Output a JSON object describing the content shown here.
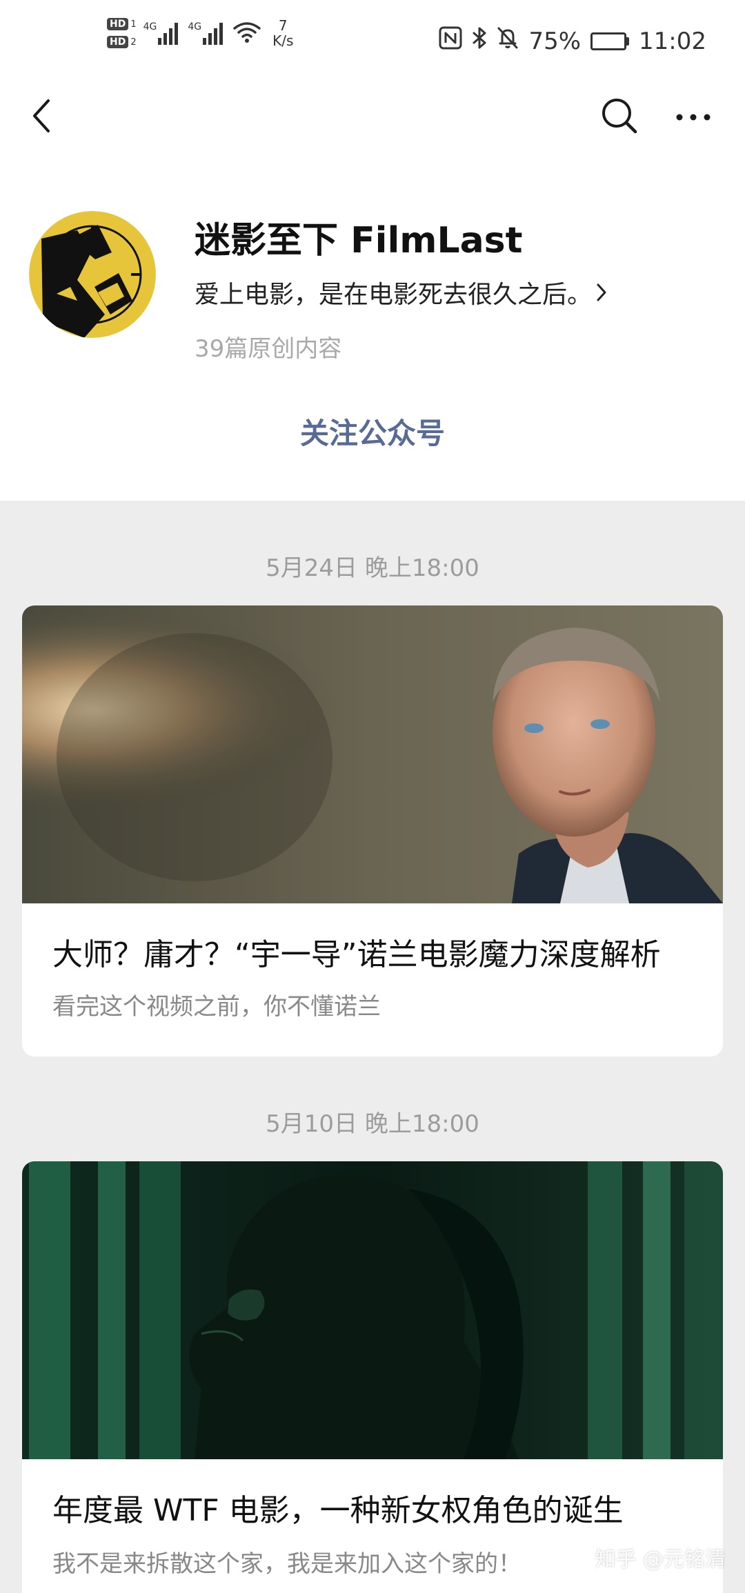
{
  "status_bar": {
    "hd1": "HD",
    "hd1_num": "1",
    "hd2": "HD",
    "hd2_num": "2",
    "net1": "4G",
    "net2": "4G",
    "speed_value": "7",
    "speed_unit": "K/s",
    "battery": "75%",
    "battery_level": 0.75,
    "time": "11:02"
  },
  "nav": {
    "back_icon": "chevron-left-icon",
    "search_icon": "search-icon",
    "more_icon": "more-horizontal-icon"
  },
  "account": {
    "name": "迷影至下 FilmLast",
    "description": "爱上电影，是在电影死去很久之后。",
    "count": "39篇原创内容",
    "follow_label": "关注公众号",
    "accent_color": "#576b95"
  },
  "feed": [
    {
      "date": "5月24日 晚上18:00",
      "title": "大师？庸才？“宇一导”诺兰电影魔力深度解析",
      "subtitle": "看完这个视频之前，你不懂诺兰"
    },
    {
      "date": "5月10日 晚上18:00",
      "title": "年度最 WTF 电影，一种新女权角色的诞生",
      "subtitle": "我不是来拆散这个家，我是来加入这个家的！"
    }
  ],
  "watermark": "知乎 @元铭清"
}
